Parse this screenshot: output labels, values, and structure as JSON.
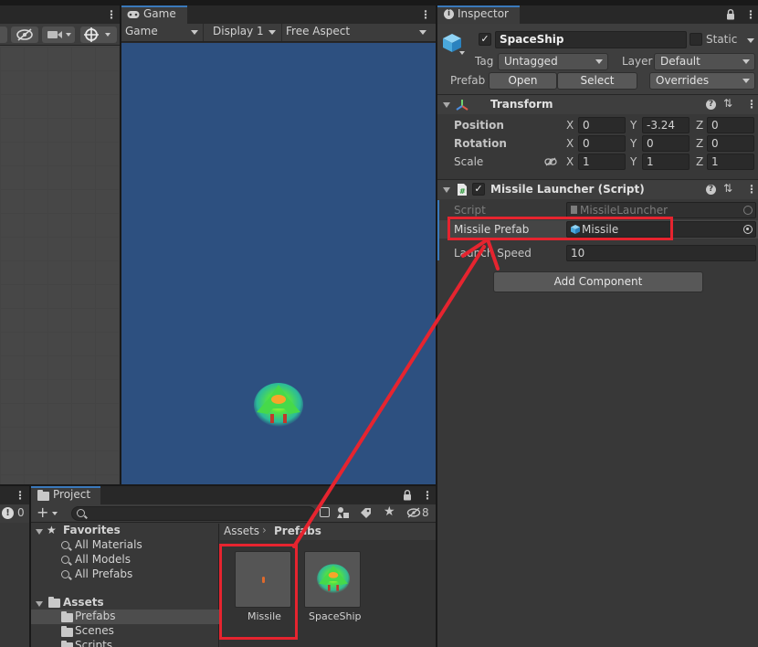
{
  "scene": {
    "tools": [
      "visibility-off-icon",
      "camera-icon",
      "gizmo-icon"
    ]
  },
  "game": {
    "tab_label": "Game",
    "mode_dropdown": "Game",
    "display_dropdown": "Display 1",
    "aspect_dropdown": "Free Aspect",
    "background_color": "#2d5080"
  },
  "inspector": {
    "tab_label": "Inspector",
    "object_name": "SpaceShip",
    "static_label": "Static",
    "tag_label": "Tag",
    "tag_value": "Untagged",
    "layer_label": "Layer",
    "layer_value": "Default",
    "prefab_label": "Prefab",
    "open_label": "Open",
    "select_label": "Select",
    "overrides_label": "Overrides",
    "transform": {
      "title": "Transform",
      "position_label": "Position",
      "rotation_label": "Rotation",
      "scale_label": "Scale",
      "position": {
        "x": "0",
        "y": "-3.24",
        "z": "0"
      },
      "rotation": {
        "x": "0",
        "y": "0",
        "z": "0"
      },
      "scale": {
        "x": "1",
        "y": "1",
        "z": "1"
      },
      "axis_x": "X",
      "axis_y": "Y",
      "axis_z": "Z"
    },
    "missile_launcher": {
      "title": "Missile Launcher (Script)",
      "script_label": "Script",
      "script_value": "MissileLauncher",
      "prefab_label": "Missile Prefab",
      "prefab_value": "Missile",
      "speed_label": "Launch Speed",
      "speed_value": "10"
    },
    "add_component_label": "Add Component"
  },
  "console": {
    "count": "0"
  },
  "project": {
    "tab_label": "Project",
    "hidden_count": "8",
    "favorites_label": "Favorites",
    "favorites": [
      "All Materials",
      "All Models",
      "All Prefabs"
    ],
    "assets_label": "Assets",
    "asset_folders": [
      "Prefabs",
      "Scenes",
      "Scripts"
    ],
    "breadcrumb_root": "Assets",
    "breadcrumb_current": "Prefabs",
    "items": [
      {
        "name": "Missile"
      },
      {
        "name": "SpaceShip"
      }
    ]
  },
  "colors": {
    "annotation_red": "#e6242f",
    "selection_blue": "#2c5d87",
    "ship_green": "#3fd94a"
  }
}
